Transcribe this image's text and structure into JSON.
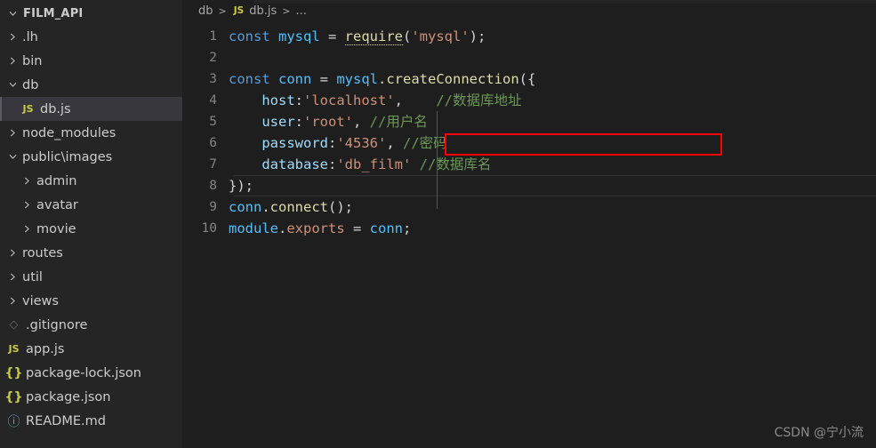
{
  "sidebar": {
    "root": {
      "label": "FILM_API",
      "expanded": true,
      "chevron": "chevron-down-icon"
    },
    "items": [
      {
        "label": ".lh",
        "type": "folder",
        "depth": 1,
        "expanded": false,
        "icon": "chevron-right-icon"
      },
      {
        "label": "bin",
        "type": "folder",
        "depth": 1,
        "expanded": false,
        "icon": "chevron-right-icon"
      },
      {
        "label": "db",
        "type": "folder",
        "depth": 1,
        "expanded": true,
        "icon": "chevron-down-icon"
      },
      {
        "label": "db.js",
        "type": "file",
        "depth": 2,
        "icon": "js-file-icon",
        "selected": true
      },
      {
        "label": "node_modules",
        "type": "folder",
        "depth": 1,
        "expanded": false,
        "icon": "chevron-right-icon"
      },
      {
        "label": "public\\images",
        "type": "folder",
        "depth": 1,
        "expanded": true,
        "icon": "chevron-down-icon"
      },
      {
        "label": "admin",
        "type": "folder",
        "depth": 2,
        "expanded": false,
        "icon": "chevron-right-icon"
      },
      {
        "label": "avatar",
        "type": "folder",
        "depth": 2,
        "expanded": false,
        "icon": "chevron-right-icon"
      },
      {
        "label": "movie",
        "type": "folder",
        "depth": 2,
        "expanded": false,
        "icon": "chevron-right-icon"
      },
      {
        "label": "routes",
        "type": "folder",
        "depth": 1,
        "expanded": false,
        "icon": "chevron-right-icon"
      },
      {
        "label": "util",
        "type": "folder",
        "depth": 1,
        "expanded": false,
        "icon": "chevron-right-icon"
      },
      {
        "label": "views",
        "type": "folder",
        "depth": 1,
        "expanded": false,
        "icon": "chevron-right-icon"
      },
      {
        "label": ".gitignore",
        "type": "file",
        "depth": 1,
        "icon": "git-file-icon"
      },
      {
        "label": "app.js",
        "type": "file",
        "depth": 1,
        "icon": "js-file-icon"
      },
      {
        "label": "package-lock.json",
        "type": "file",
        "depth": 1,
        "icon": "json-file-icon"
      },
      {
        "label": "package.json",
        "type": "file",
        "depth": 1,
        "icon": "json-file-icon"
      },
      {
        "label": "README.md",
        "type": "file",
        "depth": 1,
        "icon": "md-file-icon"
      }
    ]
  },
  "breadcrumb": {
    "folder": "db",
    "file": "db.js",
    "file_icon_label": "JS",
    "separator": ">",
    "ellipsis": "..."
  },
  "editor": {
    "active_line": 8,
    "lines": [
      {
        "n": "1",
        "tokens": [
          {
            "t": "const ",
            "c": "t-kw"
          },
          {
            "t": "mysql",
            "c": "t-var"
          },
          {
            "t": " = ",
            "c": "t-op"
          },
          {
            "t": "require",
            "c": "t-fn-u"
          },
          {
            "t": "(",
            "c": "t-punc"
          },
          {
            "t": "'mysql'",
            "c": "t-str"
          },
          {
            "t": ")",
            "c": "t-punc"
          },
          {
            "t": ";",
            "c": "t-punc"
          }
        ]
      },
      {
        "n": "2",
        "tokens": []
      },
      {
        "n": "3",
        "tokens": [
          {
            "t": "const ",
            "c": "t-kw"
          },
          {
            "t": "conn",
            "c": "t-var"
          },
          {
            "t": " = ",
            "c": "t-op"
          },
          {
            "t": "mysql",
            "c": "t-var"
          },
          {
            "t": ".",
            "c": "t-punc"
          },
          {
            "t": "createConnection",
            "c": "t-fn"
          },
          {
            "t": "({",
            "c": "t-punc"
          }
        ]
      },
      {
        "n": "4",
        "tokens": [
          {
            "t": "    ",
            "c": "t-op"
          },
          {
            "t": "host",
            "c": "t-prop"
          },
          {
            "t": ":",
            "c": "t-punc"
          },
          {
            "t": "'localhost'",
            "c": "t-str"
          },
          {
            "t": ",",
            "c": "t-punc"
          },
          {
            "t": "    ",
            "c": "t-op"
          },
          {
            "t": "//数据库地址",
            "c": "t-cmt"
          }
        ]
      },
      {
        "n": "5",
        "tokens": [
          {
            "t": "    ",
            "c": "t-op"
          },
          {
            "t": "user",
            "c": "t-prop"
          },
          {
            "t": ":",
            "c": "t-punc"
          },
          {
            "t": "'root'",
            "c": "t-str"
          },
          {
            "t": ", ",
            "c": "t-punc"
          },
          {
            "t": "//用户名",
            "c": "t-cmt"
          }
        ]
      },
      {
        "n": "6",
        "tokens": [
          {
            "t": "    ",
            "c": "t-op"
          },
          {
            "t": "password",
            "c": "t-prop"
          },
          {
            "t": ":",
            "c": "t-punc"
          },
          {
            "t": "'4536'",
            "c": "t-str"
          },
          {
            "t": ", ",
            "c": "t-punc"
          },
          {
            "t": "//密码",
            "c": "t-cmt"
          }
        ]
      },
      {
        "n": "7",
        "tokens": [
          {
            "t": "    ",
            "c": "t-op"
          },
          {
            "t": "database",
            "c": "t-prop"
          },
          {
            "t": ":",
            "c": "t-punc"
          },
          {
            "t": "'db_film'",
            "c": "t-str"
          },
          {
            "t": " ",
            "c": "t-punc"
          },
          {
            "t": "//数据库名",
            "c": "t-cmt"
          }
        ]
      },
      {
        "n": "8",
        "tokens": [
          {
            "t": "});",
            "c": "t-punc"
          }
        ]
      },
      {
        "n": "9",
        "tokens": [
          {
            "t": "conn",
            "c": "t-var"
          },
          {
            "t": ".",
            "c": "t-punc"
          },
          {
            "t": "connect",
            "c": "t-fn"
          },
          {
            "t": "()",
            "c": "t-punc"
          },
          {
            "t": ";",
            "c": "t-punc"
          }
        ]
      },
      {
        "n": "10",
        "tokens": [
          {
            "t": "module",
            "c": "t-var"
          },
          {
            "t": ".",
            "c": "t-punc"
          },
          {
            "t": "exports",
            "c": "t-exp"
          },
          {
            "t": " = ",
            "c": "t-op"
          },
          {
            "t": "conn",
            "c": "t-var"
          },
          {
            "t": ";",
            "c": "t-punc"
          }
        ]
      }
    ]
  },
  "annotation": {
    "type": "rectangle",
    "color": "#ff0000",
    "targets_line": "6",
    "targets_text": "password:'4536', //密码"
  },
  "watermark": {
    "text": "CSDN @宁小流"
  },
  "colors": {
    "editor_bg": "#1e1e1e",
    "sidebar_bg": "#252526",
    "selected_row_bg": "#37373d",
    "keyword": "#569cd6",
    "variable": "#4fc1ff",
    "function": "#dcdcaa",
    "string": "#ce9178",
    "property": "#9cdcfe",
    "comment": "#6a9955",
    "line_number": "#858585",
    "annotation": "#ff0000"
  }
}
